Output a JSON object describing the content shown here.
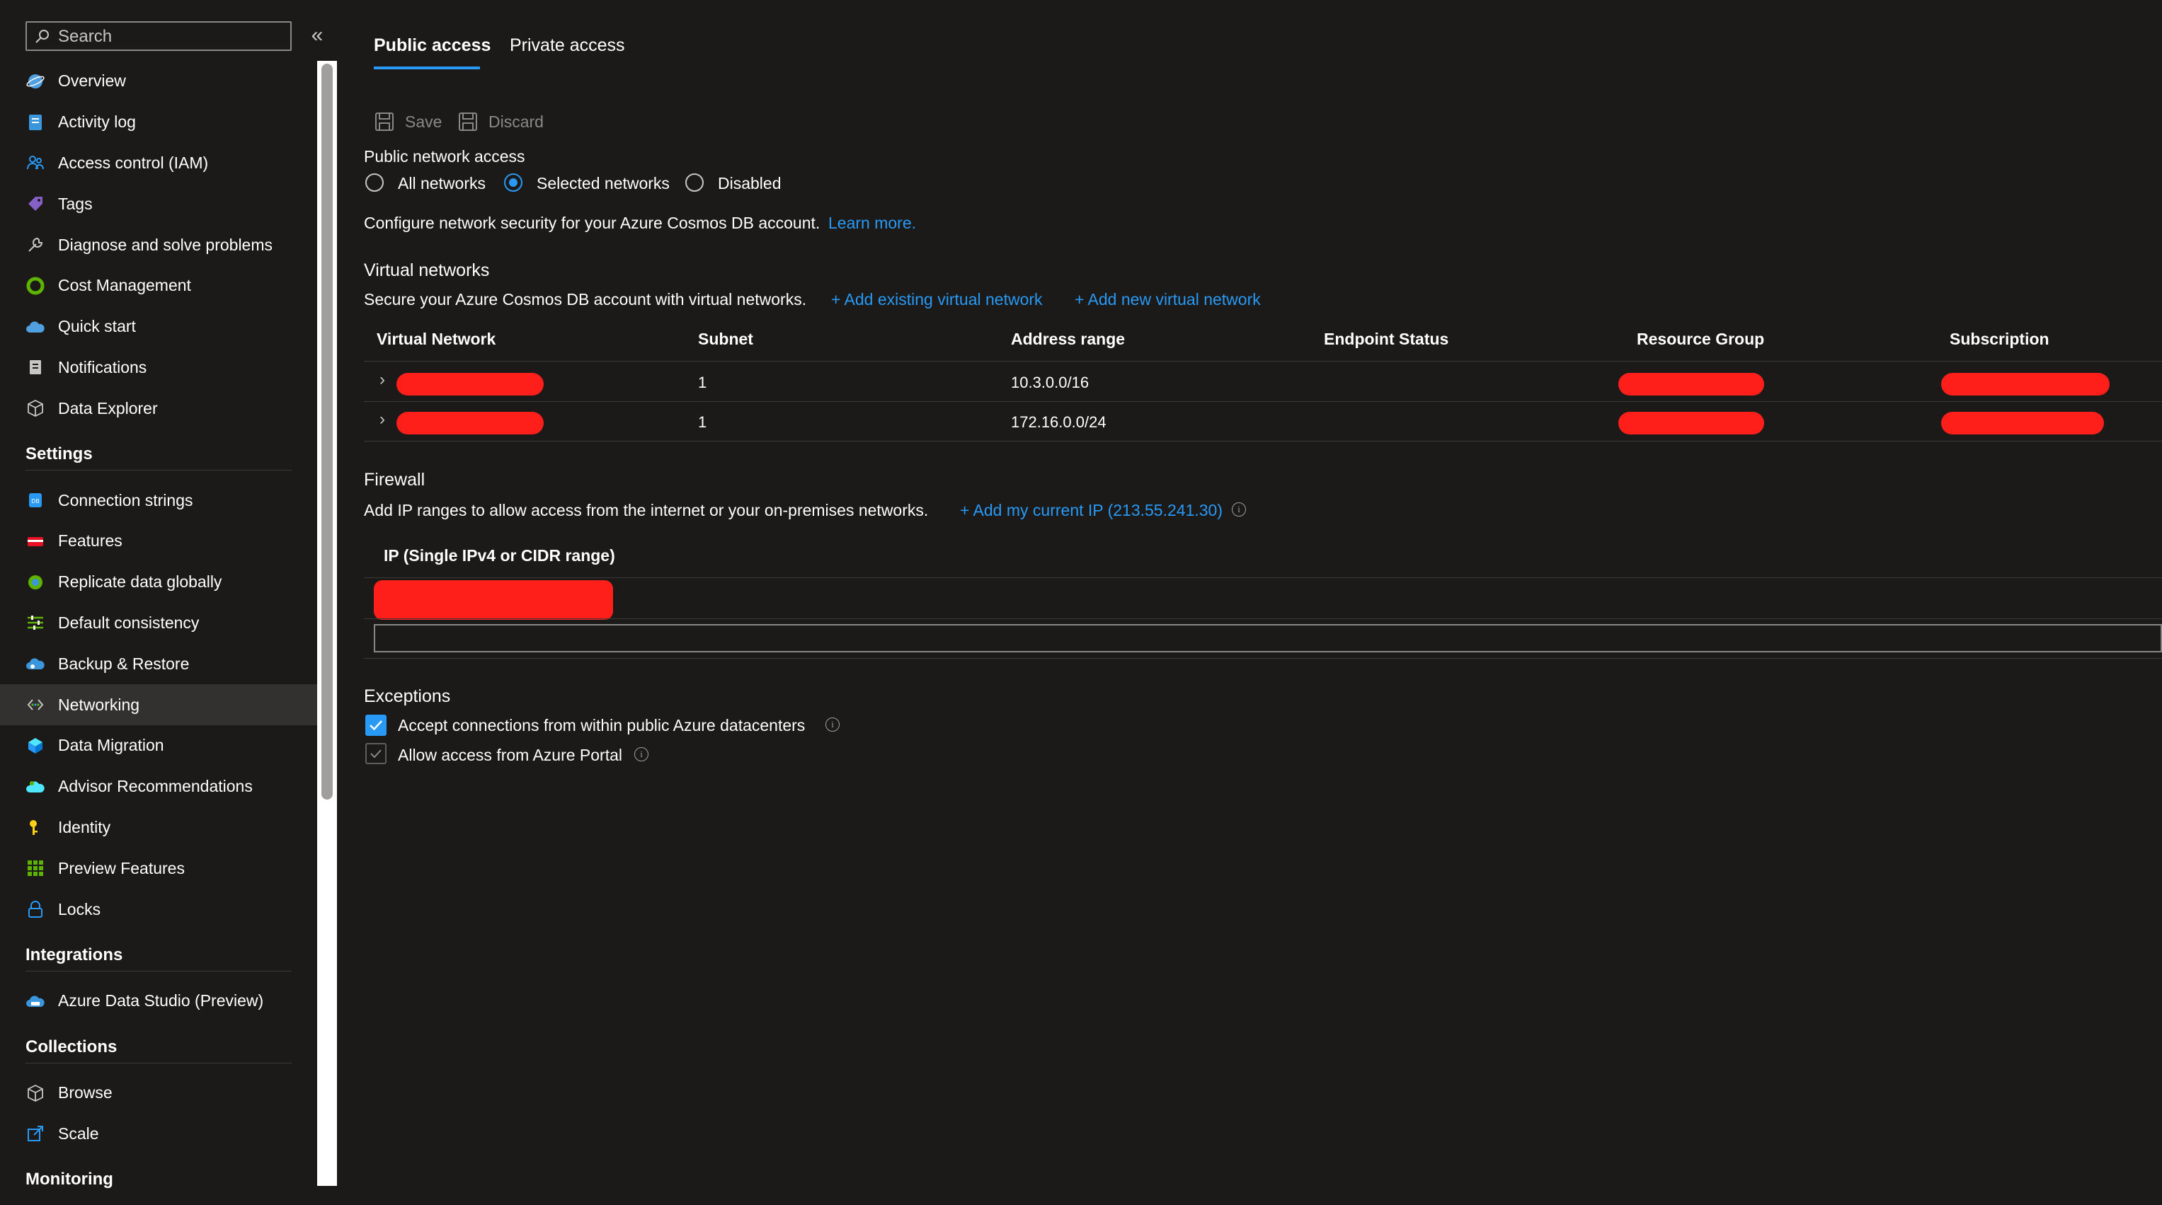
{
  "search": {
    "placeholder": "Search"
  },
  "sidebar": {
    "items": [
      {
        "label": "Overview",
        "icon": "globe-icon"
      },
      {
        "label": "Activity log",
        "icon": "activity-log-icon"
      },
      {
        "label": "Access control (IAM)",
        "icon": "people-icon"
      },
      {
        "label": "Tags",
        "icon": "tag-icon"
      },
      {
        "label": "Diagnose and solve problems",
        "icon": "wrench-icon"
      },
      {
        "label": "Cost Management",
        "icon": "cost-icon"
      },
      {
        "label": "Quick start",
        "icon": "cloud-icon"
      },
      {
        "label": "Notifications",
        "icon": "notification-icon"
      },
      {
        "label": "Data Explorer",
        "icon": "cube-icon"
      }
    ],
    "sections": [
      {
        "title": "Settings",
        "items": [
          {
            "label": "Connection strings",
            "icon": "db-icon"
          },
          {
            "label": "Features",
            "icon": "features-icon"
          },
          {
            "label": "Replicate data globally",
            "icon": "globe-replicate-icon"
          },
          {
            "label": "Default consistency",
            "icon": "sliders-icon"
          },
          {
            "label": "Backup & Restore",
            "icon": "backup-icon"
          },
          {
            "label": "Networking",
            "icon": "networking-icon",
            "active": true
          },
          {
            "label": "Data Migration",
            "icon": "migration-icon"
          },
          {
            "label": "Advisor Recommendations",
            "icon": "advisor-icon"
          },
          {
            "label": "Identity",
            "icon": "key-icon"
          },
          {
            "label": "Preview Features",
            "icon": "grid-icon"
          },
          {
            "label": "Locks",
            "icon": "lock-icon"
          }
        ]
      },
      {
        "title": "Integrations",
        "items": [
          {
            "label": "Azure Data Studio (Preview)",
            "icon": "data-studio-icon"
          }
        ]
      },
      {
        "title": "Collections",
        "items": [
          {
            "label": "Browse",
            "icon": "cube-icon"
          },
          {
            "label": "Scale",
            "icon": "scale-icon"
          }
        ]
      },
      {
        "title": "Monitoring",
        "items": []
      }
    ]
  },
  "tabs": [
    {
      "label": "Public access",
      "active": true
    },
    {
      "label": "Private access",
      "active": false
    }
  ],
  "toolbar": {
    "save_label": "Save",
    "discard_label": "Discard"
  },
  "public_network_access": {
    "label": "Public network access",
    "options": [
      {
        "label": "All networks",
        "checked": false
      },
      {
        "label": "Selected networks",
        "checked": true
      },
      {
        "label": "Disabled",
        "checked": false
      }
    ]
  },
  "configure": {
    "text": "Configure network security for your Azure Cosmos DB account.",
    "link": "Learn more."
  },
  "virtual_networks": {
    "title": "Virtual networks",
    "description": "Secure your Azure Cosmos DB account with virtual networks.",
    "add_existing": "+ Add existing virtual network",
    "add_new": "+ Add new virtual network",
    "columns": [
      "Virtual Network",
      "Subnet",
      "Address range",
      "Endpoint Status",
      "Resource Group",
      "Subscription"
    ],
    "rows": [
      {
        "subnet": "1",
        "address_range": "10.3.0.0/16"
      },
      {
        "subnet": "1",
        "address_range": "172.16.0.0/24"
      }
    ]
  },
  "firewall": {
    "title": "Firewall",
    "description": "Add IP ranges to allow access from the internet or your on-premises networks.",
    "add_ip": "+ Add my current IP (213.55.241.30)",
    "column": "IP (Single IPv4 or CIDR range)",
    "input_value": ""
  },
  "exceptions": {
    "title": "Exceptions",
    "items": [
      {
        "label": "Accept connections from within public Azure datacenters",
        "checked": true
      },
      {
        "label": "Allow access from Azure Portal",
        "checked": true,
        "disabled": true
      }
    ]
  },
  "colors": {
    "accent": "#2899f5",
    "redaction": "#fe1e1a",
    "background": "#1b1a19",
    "active_row": "#323130"
  }
}
